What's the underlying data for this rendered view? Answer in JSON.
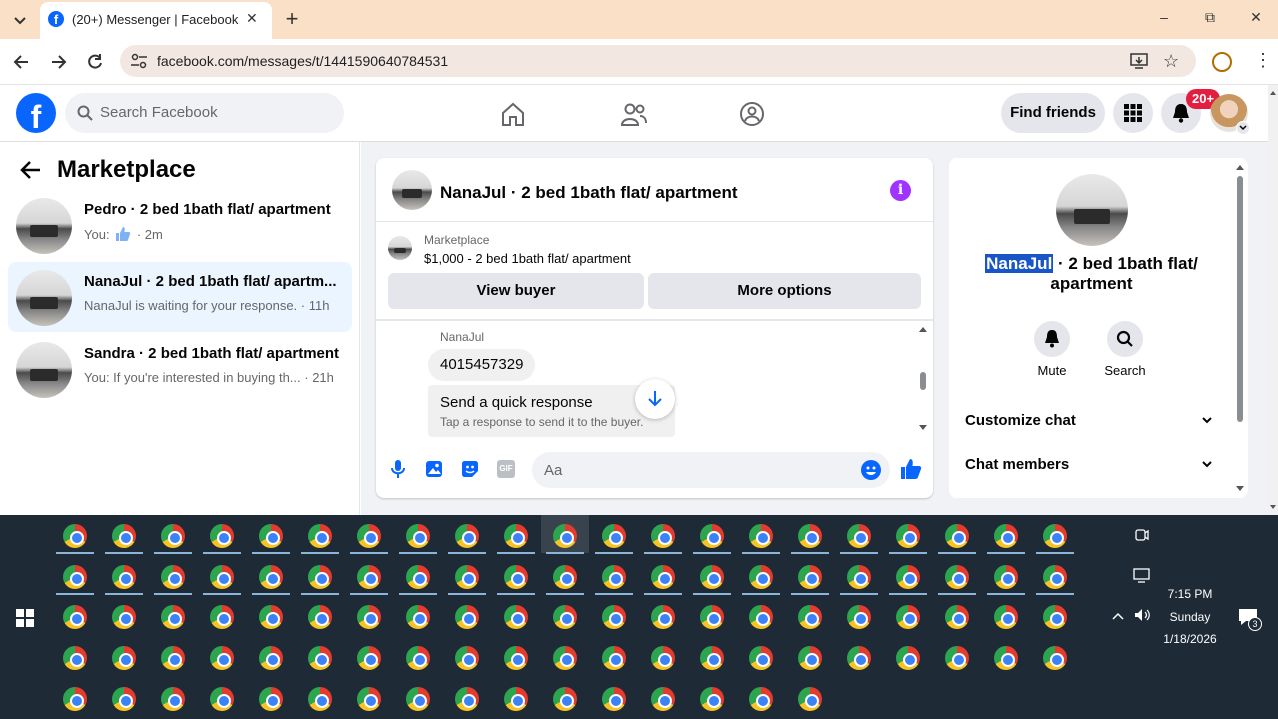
{
  "browser": {
    "tab_title": "(20+) Messenger | Facebook",
    "url": "facebook.com/messages/t/1441590640784531",
    "new_tab_label": "+",
    "window": {
      "minimize": "–",
      "maximize": "⧉",
      "close": "✕"
    }
  },
  "fb_header": {
    "search_placeholder": "Search Facebook",
    "find_friends": "Find friends",
    "notification_badge": "20+"
  },
  "left_panel": {
    "title": "Marketplace",
    "conversations": [
      {
        "name": "Pedro · 2 bed 1bath flat/ apartment",
        "preview_prefix": "You:",
        "preview": "· 2m",
        "active": false
      },
      {
        "name": "NanaJul · 2 bed 1bath flat/ apartm...",
        "preview": "NanaJul is waiting for your response. · 11h",
        "active": true
      },
      {
        "name": "Sandra · 2 bed 1bath flat/ apartment",
        "preview": "You: If you're interested in buying th... · 21h",
        "active": false
      }
    ]
  },
  "chat": {
    "title": "NanaJul · 2 bed 1bath flat/ apartment",
    "listing_label": "Marketplace",
    "listing_price_title": "$1,000 - 2 bed 1bath flat/ apartment",
    "view_buyer": "View buyer",
    "more_options": "More options",
    "sender_name": "NanaJul",
    "message": "4015457329",
    "quick_response_title": "Send a quick response",
    "quick_response_sub": "Tap a response to send it to the buyer.",
    "input_placeholder": "Aa"
  },
  "info_panel": {
    "name_highlight": "NanaJul",
    "title_rest": "· 2 bed 1bath flat/",
    "title_line2": "apartment",
    "mute": "Mute",
    "search": "Search",
    "customize_chat": "Customize chat",
    "chat_members": "Chat members"
  },
  "taskbar": {
    "time": "7:15 PM",
    "day": "Sunday",
    "date": "1/18/2026",
    "notification_count": "3"
  },
  "colors": {
    "brand_blue": "#0866ff",
    "messenger_purple": "#a033ff",
    "tab_strip": "#f9e0c6",
    "selection": "#1a55c7",
    "taskbar": "#1e2a35"
  }
}
